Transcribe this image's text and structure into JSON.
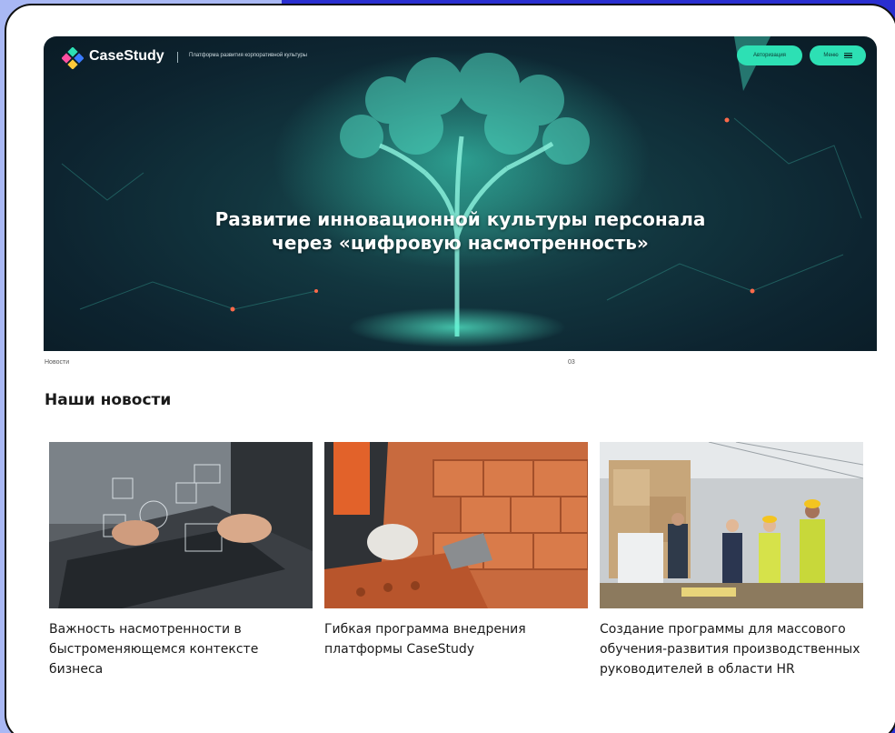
{
  "header": {
    "logo_text": "CaseStudy",
    "tagline": "Платформа развития корпоративной культуры",
    "auth_button": "Авторизация",
    "menu_button": "Меню"
  },
  "hero": {
    "title_line1": "Развитие инновационной культуры персонала",
    "title_line2": "через «цифровую насмотренность»"
  },
  "section": {
    "breadcrumb": "Новости",
    "counter": "03",
    "title": "Наши новости"
  },
  "news": [
    {
      "caption": "Важность насмотренности в быстроменяющемся контексте бизнеса",
      "image": "laptop-digital-icons-photo"
    },
    {
      "caption": "Гибкая программа внедрения платформы CaseStudy",
      "image": "bricklayer-photo"
    },
    {
      "caption": "Создание программы для массового обучения-развития производственных руководителей в области HR",
      "image": "warehouse-team-photo"
    }
  ],
  "colors": {
    "accent": "#2de0b4",
    "page_bg": "#2a2fd0",
    "panel_bg": "#a9b8f4"
  }
}
